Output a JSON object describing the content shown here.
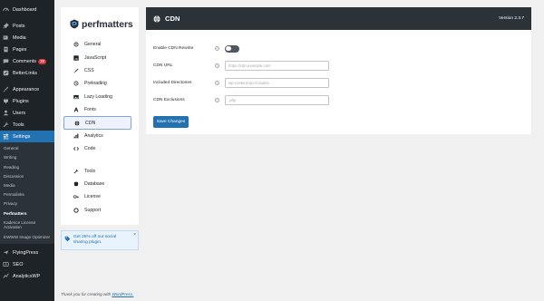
{
  "wp_menu": {
    "items": [
      {
        "label": "Dashboard",
        "icon": "dashboard-icon"
      },
      {
        "label": "Posts",
        "icon": "pin-icon"
      },
      {
        "label": "Media",
        "icon": "media-icon"
      },
      {
        "label": "Pages",
        "icon": "pages-icon"
      },
      {
        "label": "Comments",
        "icon": "comment-icon",
        "badge": "28"
      },
      {
        "label": "BetterLinks",
        "icon": "link-icon"
      },
      {
        "label": "Appearance",
        "icon": "brush-icon"
      },
      {
        "label": "Plugins",
        "icon": "plugin-icon"
      },
      {
        "label": "Users",
        "icon": "users-icon"
      },
      {
        "label": "Tools",
        "icon": "wrench-icon"
      },
      {
        "label": "Settings",
        "icon": "settings-icon"
      }
    ],
    "submenu": [
      "General",
      "Writing",
      "Reading",
      "Discussion",
      "Media",
      "Permalinks",
      "Privacy",
      "Perfmatters",
      "Kadence License Activation",
      "EWWW Image Optimizer"
    ],
    "bottom_items": [
      {
        "label": "FlyingPress",
        "icon": "flyingpress-icon"
      },
      {
        "label": "SEO",
        "icon": "seo-icon"
      },
      {
        "label": "AnalyticsWP",
        "icon": "analytics-icon"
      }
    ]
  },
  "perfmatters": {
    "logo_text": "perfmatters",
    "nav": [
      {
        "label": "General",
        "icon": "general-icon"
      },
      {
        "label": "JavaScript",
        "icon": "javascript-icon"
      },
      {
        "label": "CSS",
        "icon": "css-icon"
      },
      {
        "label": "Preloading",
        "icon": "preloading-icon"
      },
      {
        "label": "Lazy Loading",
        "icon": "lazy-loading-icon"
      },
      {
        "label": "Fonts",
        "icon": "fonts-icon"
      },
      {
        "label": "CDN",
        "icon": "cdn-icon"
      },
      {
        "label": "Analytics",
        "icon": "analytics-chart-icon"
      },
      {
        "label": "Code",
        "icon": "code-icon"
      }
    ],
    "nav_bottom": [
      {
        "label": "Tools",
        "icon": "tools-icon"
      },
      {
        "label": "Database",
        "icon": "database-icon"
      },
      {
        "label": "License",
        "icon": "license-key-icon"
      },
      {
        "label": "Support",
        "icon": "support-icon"
      }
    ],
    "promo_text": "Get 25% off our social sharing plugin.",
    "promo_close": "×"
  },
  "footer": {
    "prefix": "Thank you for creating with ",
    "link": "WordPress."
  },
  "cdn_panel": {
    "title": "CDN",
    "version": "Version 2.3.7",
    "fields": {
      "enable_label": "Enable CDN Rewrite",
      "url_label": "CDN URL",
      "url_placeholder": "https://cdn.example.com",
      "dirs_label": "Included Directories",
      "dirs_placeholder": "wp-content,wp-includes",
      "excl_label": "CDN Exclusions",
      "excl_placeholder": ".php"
    },
    "help_glyph": "?",
    "save_label": "Save Changes",
    "enable_cdn_rewrite": false
  },
  "colors": {
    "wp_sidebar_bg": "#1d2327",
    "accent_blue": "#2271b1",
    "panel_header_bg": "#2c3338"
  }
}
